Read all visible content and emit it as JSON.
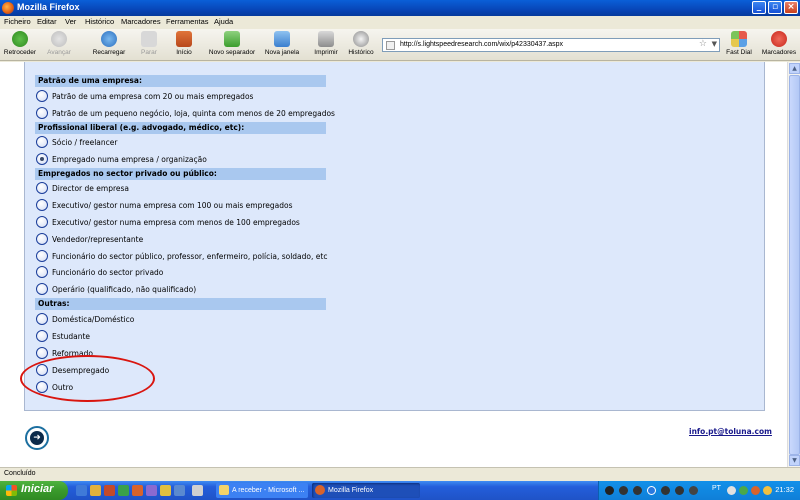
{
  "window": {
    "title": "Mozilla Firefox"
  },
  "menu": [
    "Ficheiro",
    "Editar",
    "Ver",
    "Histórico",
    "Marcadores",
    "Ferramentas",
    "Ajuda"
  ],
  "toolbar": {
    "back": "Retroceder",
    "forward": "Avançar",
    "reload": "Recarregar",
    "stop": "Parar",
    "home": "Início",
    "new_tab": "Novo separador",
    "new_window": "Nova janela",
    "print": "Imprimir",
    "history": "Histórico",
    "url": "http://s.lightspeedresearch.com/wix/p42330437.aspx",
    "fast_dial": "Fast Dial",
    "bookmarks": "Marcadores"
  },
  "survey": {
    "groups": [
      {
        "header": "Patrão de uma empresa:",
        "options": [
          {
            "label": "Patrão de uma empresa com 20 ou mais empregados",
            "checked": false
          },
          {
            "label": "Patrão de um pequeno negócio, loja, quinta com menos de 20 empregados",
            "checked": false
          }
        ]
      },
      {
        "header": "Profissional liberal (e.g. advogado, médico, etc):",
        "options": [
          {
            "label": "Sócio / freelancer",
            "checked": false
          },
          {
            "label": "Empregado numa empresa / organização",
            "checked": true
          }
        ]
      },
      {
        "header": "Empregados no sector privado ou público:",
        "options": [
          {
            "label": "Director de empresa",
            "checked": false
          },
          {
            "label": "Executivo/ gestor numa empresa com 100 ou mais empregados",
            "checked": false
          },
          {
            "label": "Executivo/ gestor numa empresa com menos de 100 empregados",
            "checked": false
          },
          {
            "label": "Vendedor/representante",
            "checked": false
          },
          {
            "label": "Funcionário do sector público, professor, enfermeiro, polícia, soldado, etc",
            "checked": false
          },
          {
            "label": "Funcionário do sector privado",
            "checked": false
          },
          {
            "label": "Operário (qualificado, não qualificado)",
            "checked": false
          }
        ]
      },
      {
        "header": "Outras:",
        "options": [
          {
            "label": "Doméstica/Doméstico",
            "checked": false
          },
          {
            "label": "Estudante",
            "checked": false
          },
          {
            "label": "Reformado",
            "checked": false
          },
          {
            "label": "Desempregado",
            "checked": false
          },
          {
            "label": "Outro",
            "checked": false
          }
        ]
      }
    ]
  },
  "footer": {
    "email": "info.pt@toluna.com"
  },
  "status": {
    "text": "Concluído"
  },
  "taskbar": {
    "start": "Iniciar",
    "tasks": [
      "A receber - Microsoft ...",
      "Mozilla Firefox"
    ],
    "language": "PT",
    "clock": "21:32"
  }
}
